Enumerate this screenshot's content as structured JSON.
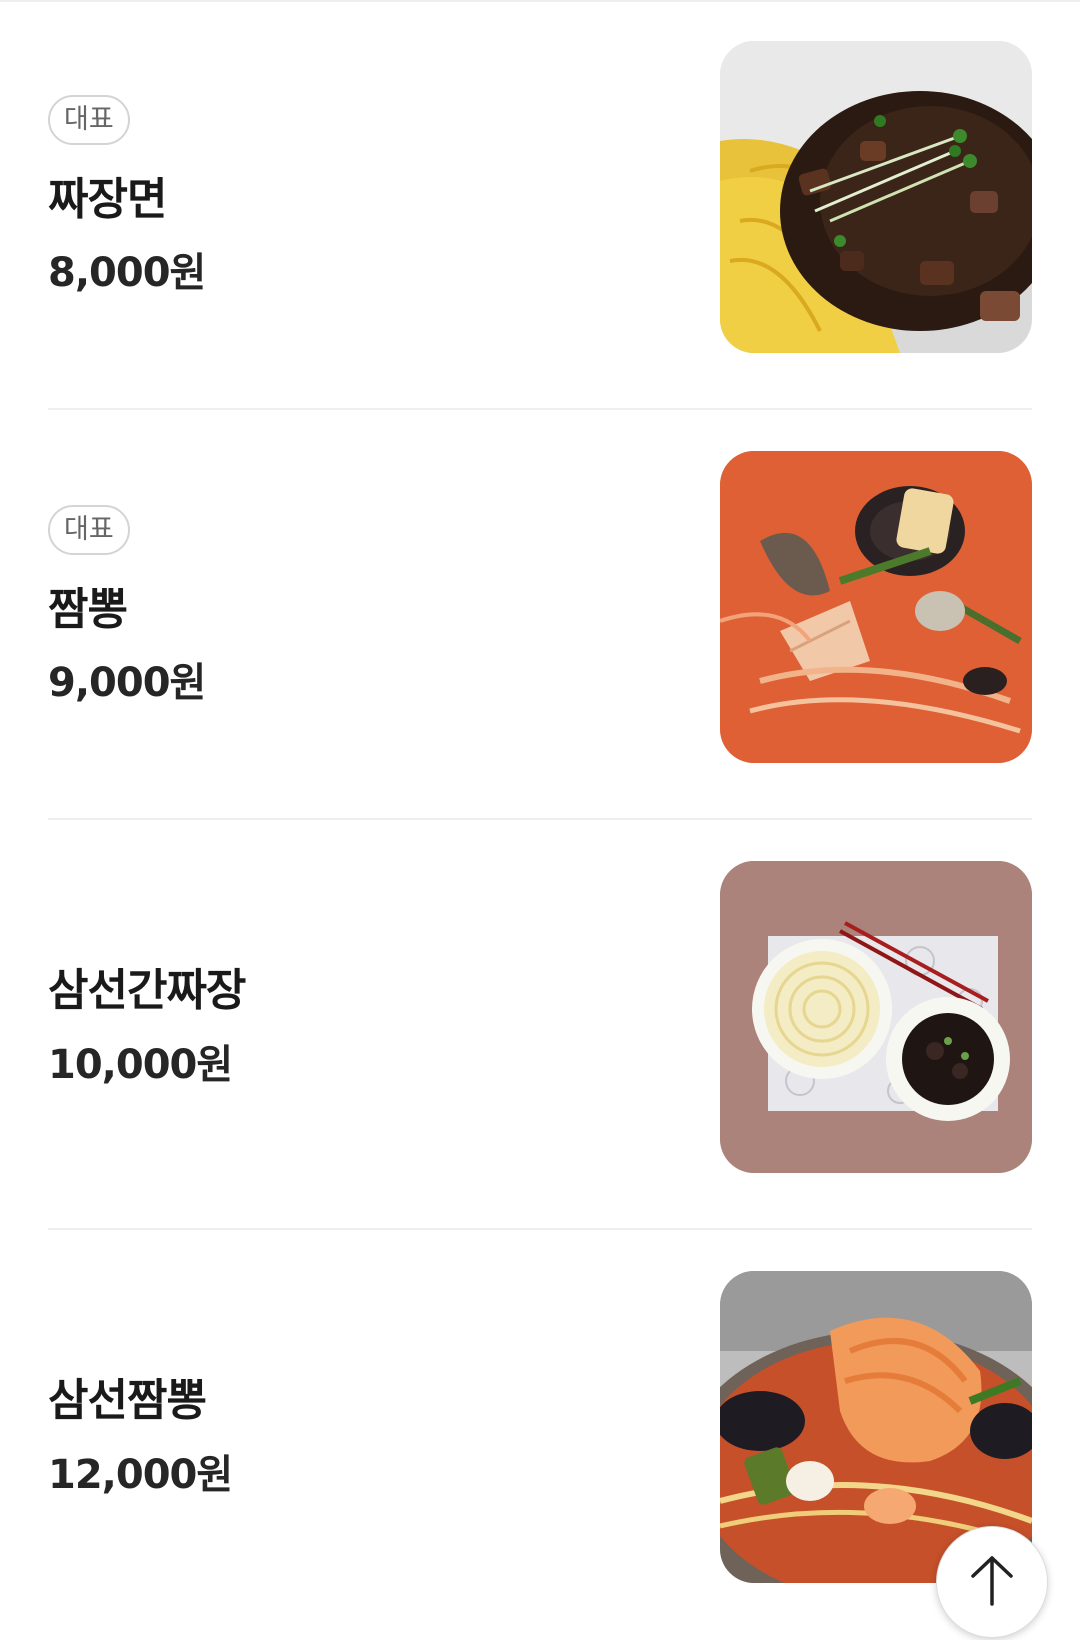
{
  "menu": {
    "items": [
      {
        "badge": "대표",
        "name": "짜장면",
        "price": "8,000원",
        "image_icon": "jjajangmyeon-photo"
      },
      {
        "badge": "대표",
        "name": "짬뽕",
        "price": "9,000원",
        "image_icon": "jjamppong-photo"
      },
      {
        "name": "삼선간짜장",
        "price": "10,000원",
        "image_icon": "samseon-ganjjajang-photo"
      },
      {
        "name": "삼선짬뽕",
        "price": "12,000원",
        "image_icon": "samseon-jjamppong-photo"
      }
    ]
  },
  "scroll_top": {
    "icon": "arrow-up-icon"
  }
}
